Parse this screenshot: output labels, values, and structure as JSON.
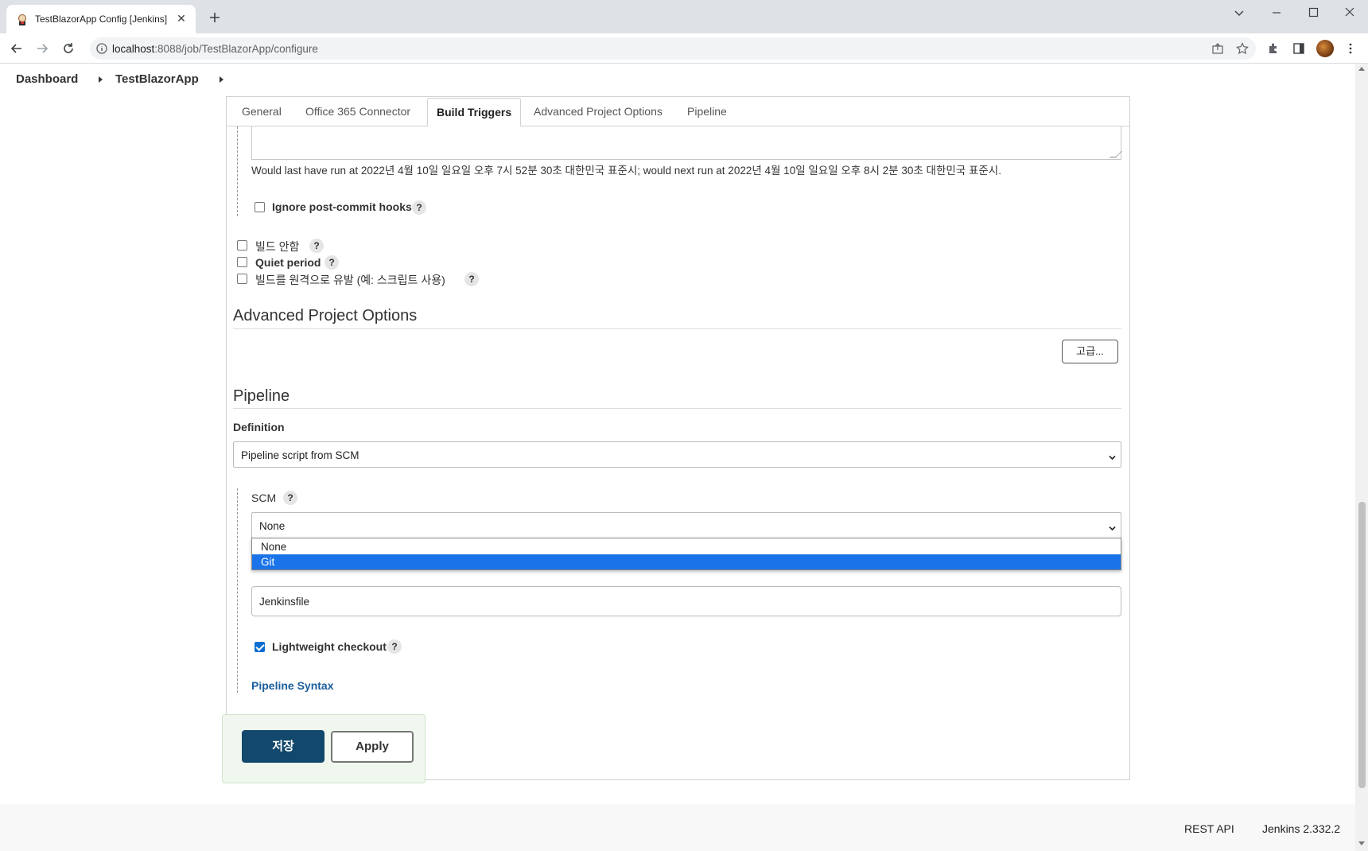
{
  "browser": {
    "tab_title": "TestBlazorApp Config [Jenkins]",
    "url_host": "localhost",
    "url_path": ":8088/job/TestBlazorApp/configure"
  },
  "breadcrumb": {
    "items": [
      "Dashboard",
      "TestBlazorApp"
    ]
  },
  "config_tabs": [
    "General",
    "Office 365 Connector",
    "Build Triggers",
    "Advanced Project Options",
    "Pipeline"
  ],
  "build_triggers": {
    "schedule_note": "Would last have run at 2022년 4월 10일 일요일 오후 7시 52분 30초 대한민국 표준시; would next run at 2022년 4월 10일 일요일 오후 8시 2분 30초 대한민국 표준시.",
    "ignore_post_commit": "Ignore post-commit hooks",
    "disable_build": "빌드 안함",
    "quiet_period": "Quiet period",
    "remote_trigger": "빌드를 원격으로 유발 (예: 스크립트 사용)"
  },
  "advanced_project_options": {
    "title": "Advanced Project Options",
    "advanced_button": "고급..."
  },
  "pipeline": {
    "title": "Pipeline",
    "definition_label": "Definition",
    "definition_value": "Pipeline script from SCM",
    "scm_label": "SCM",
    "scm_value": "None",
    "scm_options": [
      "None",
      "Git"
    ],
    "scm_highlighted": "Git",
    "script_path_value": "Jenkinsfile",
    "lightweight_checkout": "Lightweight checkout",
    "lightweight_checked": true,
    "syntax_link": "Pipeline Syntax"
  },
  "buttons": {
    "save": "저장",
    "apply": "Apply"
  },
  "footer": {
    "rest_api": "REST API",
    "version": "Jenkins 2.332.2"
  },
  "help_glyph": "?",
  "colors": {
    "save_button": "#11486c",
    "link": "#1a5d9c",
    "dropdown_highlight": "#1a73e8",
    "checkbox_checked": "#0b6ed0"
  }
}
